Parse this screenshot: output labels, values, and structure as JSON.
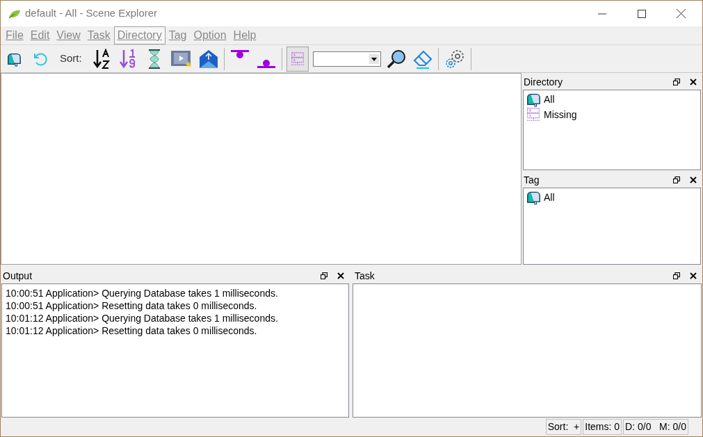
{
  "window": {
    "title": "default - All - Scene Explorer"
  },
  "menu": [
    {
      "label": "File",
      "selected": false
    },
    {
      "label": "Edit",
      "selected": false
    },
    {
      "label": "View",
      "selected": false
    },
    {
      "label": "Task",
      "selected": false
    },
    {
      "label": "Directory",
      "selected": true
    },
    {
      "label": "Tag",
      "selected": false
    },
    {
      "label": "Option",
      "selected": false
    },
    {
      "label": "Help",
      "selected": false
    }
  ],
  "toolbar": [
    {
      "kind": "mailbox",
      "pressed": false
    },
    {
      "kind": "refresh",
      "pressed": false
    },
    {
      "kind": "label",
      "text": "Sort:"
    },
    {
      "kind": "sort-az",
      "pressed": false
    },
    {
      "kind": "sort-19",
      "pressed": false
    },
    {
      "kind": "hourglass",
      "pressed": false
    },
    {
      "kind": "film",
      "pressed": false
    },
    {
      "kind": "upload",
      "pressed": false
    },
    {
      "kind": "separator"
    },
    {
      "kind": "top",
      "pressed": false
    },
    {
      "kind": "bottom",
      "pressed": false
    },
    {
      "kind": "separator"
    },
    {
      "kind": "server",
      "pressed": true
    },
    {
      "kind": "combo"
    },
    {
      "kind": "search",
      "pressed": false
    },
    {
      "kind": "eraser",
      "pressed": false
    },
    {
      "kind": "separator"
    },
    {
      "kind": "gear",
      "pressed": false
    },
    {
      "kind": "separator"
    }
  ],
  "directory": {
    "title": "Directory",
    "items": [
      {
        "kind": "mailbox",
        "label": "All"
      },
      {
        "kind": "server",
        "label": "Missing"
      }
    ]
  },
  "tag": {
    "title": "Tag",
    "items": [
      {
        "kind": "mailbox",
        "label": "All"
      }
    ]
  },
  "output": {
    "title": "Output",
    "lines": [
      "10:00:51 Application> Querying Database takes 1 milliseconds.",
      "10:00:51 Application> Resetting data takes 0 milliseconds.",
      "10:01:12 Application> Querying Database takes 1 milliseconds.",
      "10:01:12 Application> Resetting data takes 0 milliseconds."
    ]
  },
  "task": {
    "title": "Task"
  },
  "status_bar": [
    "Sort:  +",
    "Items: 0",
    "D: 0/0   M: 0/0"
  ]
}
